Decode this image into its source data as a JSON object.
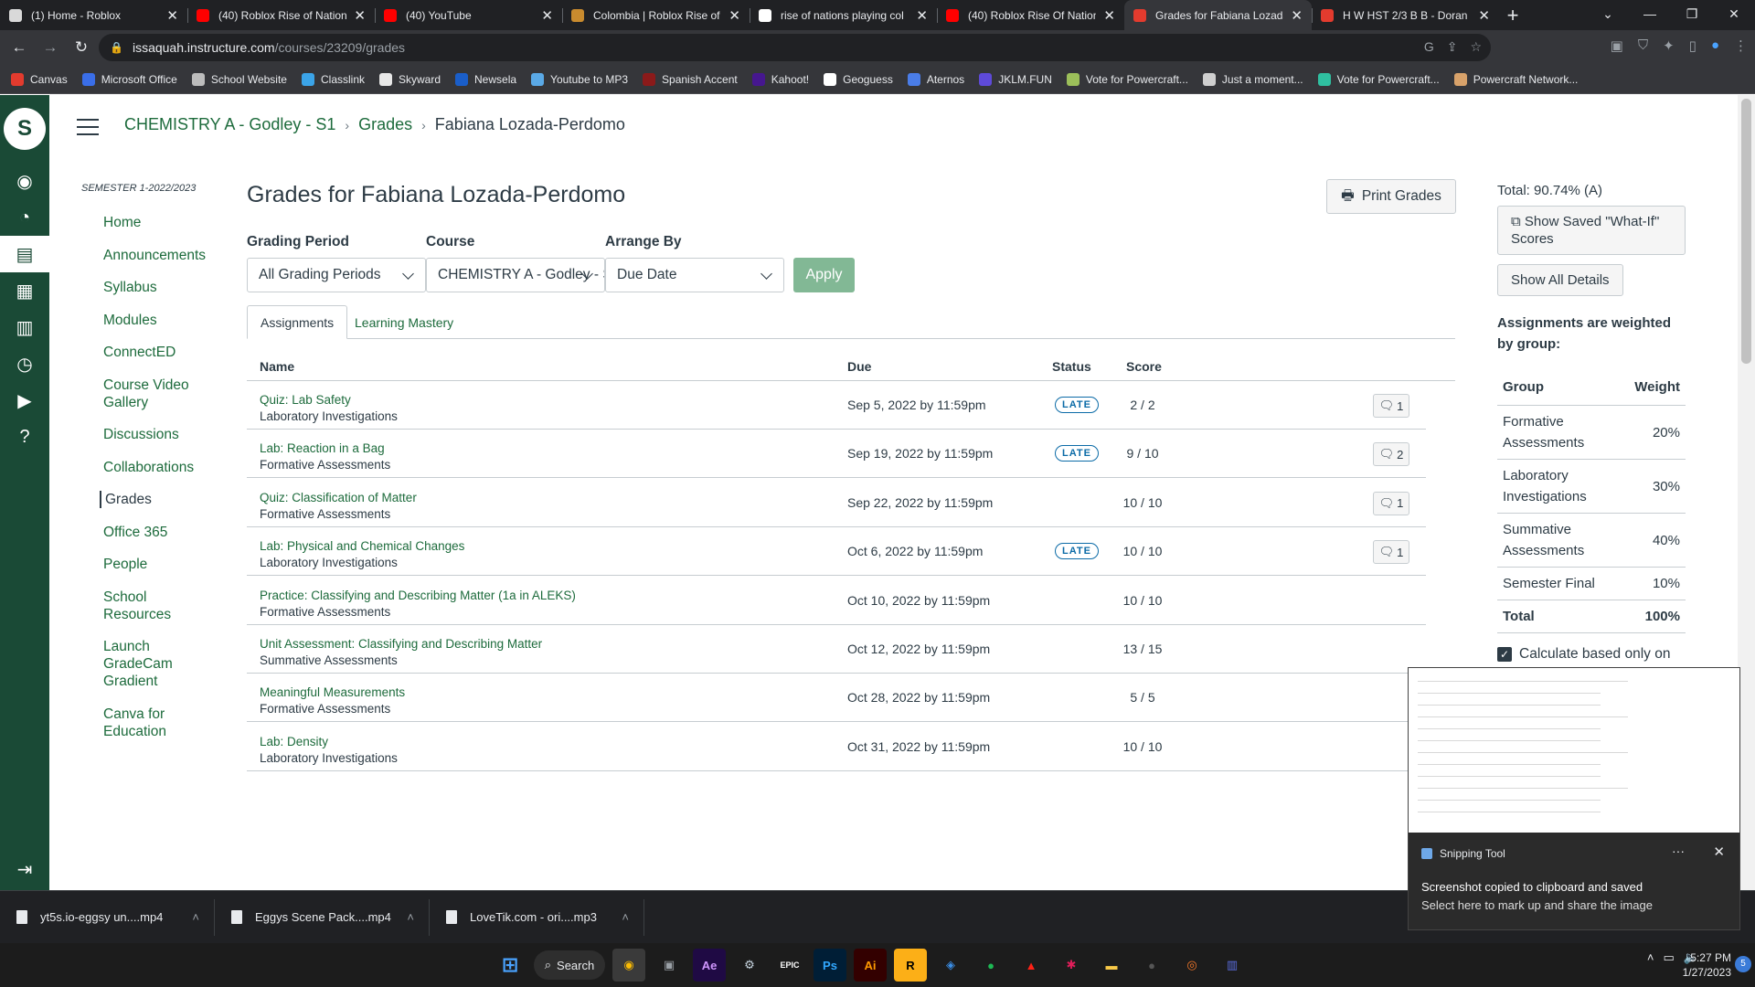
{
  "browser": {
    "tabs": [
      {
        "title": "(1) Home - Roblox",
        "fav": "#d9d9d9"
      },
      {
        "title": "(40) Roblox Rise of Nations",
        "fav": "#ff0000"
      },
      {
        "title": "(40) YouTube",
        "fav": "#ff0000"
      },
      {
        "title": "Colombia | Roblox Rise of",
        "fav": "#c98b2e"
      },
      {
        "title": "rise of nations playing col",
        "fav": "#ffffff"
      },
      {
        "title": "(40) Roblox Rise Of Nation",
        "fav": "#ff0000"
      },
      {
        "title": "Grades for Fabiana Lozada",
        "fav": "#e33b2e",
        "active": true
      },
      {
        "title": "H W HST 2/3 B B - Doran",
        "fav": "#e33b2e"
      }
    ],
    "url_domain": "issaquah.instructure.com",
    "url_path": "/courses/23209/grades",
    "bookmarks": [
      {
        "label": "Canvas",
        "color": "#e33b2e"
      },
      {
        "label": "Microsoft Office",
        "color": "#3a6ee8"
      },
      {
        "label": "School Website",
        "color": "#bcbcbc"
      },
      {
        "label": "Classlink",
        "color": "#3ba4e8"
      },
      {
        "label": "Skyward",
        "color": "#e8e8e8"
      },
      {
        "label": "Newsela",
        "color": "#1a5ec9"
      },
      {
        "label": "Youtube to MP3",
        "color": "#5aa9e6"
      },
      {
        "label": "Spanish Accent",
        "color": "#8b1a1a"
      },
      {
        "label": "Kahoot!",
        "color": "#46178f"
      },
      {
        "label": "Geoguess",
        "color": "#ffffff"
      },
      {
        "label": "Aternos",
        "color": "#4a7de8"
      },
      {
        "label": "JKLM.FUN",
        "color": "#5e4ad8"
      },
      {
        "label": "Vote for Powercraft...",
        "color": "#9cbf5a"
      },
      {
        "label": "Just a moment...",
        "color": "#cfcfcf"
      },
      {
        "label": "Vote for Powercraft...",
        "color": "#2fbfa0"
      },
      {
        "label": "Powercraft Network...",
        "color": "#d8a26a"
      }
    ]
  },
  "breadcrumbs": {
    "course": "CHEMISTRY A - Godley - S1",
    "section": "Grades",
    "current": "Fabiana Lozada-Perdomo",
    "sep": "›"
  },
  "course_nav": {
    "semester": "SEMESTER 1-2022/2023",
    "items": [
      "Home",
      "Announcements",
      "Syllabus",
      "Modules",
      "ConnectED",
      "Course Video Gallery",
      "Discussions",
      "Collaborations",
      "Grades",
      "Office 365",
      "People",
      "School Resources",
      "Launch GradeCam Gradient",
      "Canva for Education"
    ],
    "active": "Grades"
  },
  "page": {
    "title": "Grades for Fabiana Lozada-Perdomo",
    "print_label": "Print Grades",
    "filters": {
      "grading_period_label": "Grading Period",
      "grading_period_value": "All Grading Periods",
      "course_label": "Course",
      "course_value": "CHEMISTRY A - Godley - S",
      "arrange_label": "Arrange By",
      "arrange_value": "Due Date",
      "apply_label": "Apply"
    },
    "tabs": [
      "Assignments",
      "Learning Mastery"
    ],
    "columns": {
      "name": "Name",
      "due": "Due",
      "status": "Status",
      "score": "Score"
    },
    "assignments": [
      {
        "name": "Quiz: Lab Safety",
        "group": "Laboratory Investigations",
        "due": "Sep 5, 2022 by 11:59pm",
        "status": "LATE",
        "score": "2 / 2",
        "comments": "1"
      },
      {
        "name": "Lab: Reaction in a Bag",
        "group": "Formative Assessments",
        "due": "Sep 19, 2022 by 11:59pm",
        "status": "LATE",
        "score": "9 / 10",
        "comments": "2"
      },
      {
        "name": "Quiz: Classification of Matter",
        "group": "Formative Assessments",
        "due": "Sep 22, 2022 by 11:59pm",
        "status": "",
        "score": "10 / 10",
        "comments": "1"
      },
      {
        "name": "Lab: Physical and Chemical Changes",
        "group": "Laboratory Investigations",
        "due": "Oct 6, 2022 by 11:59pm",
        "status": "LATE",
        "score": "10 / 10",
        "comments": "1"
      },
      {
        "name": "Practice: Classifying and Describing Matter (1a in ALEKS)",
        "group": "Formative Assessments",
        "due": "Oct 10, 2022 by 11:59pm",
        "status": "",
        "score": "10 / 10",
        "comments": ""
      },
      {
        "name": "Unit Assessment: Classifying and Describing Matter",
        "group": "Summative Assessments",
        "due": "Oct 12, 2022 by 11:59pm",
        "status": "",
        "score": "13 / 15",
        "comments": ""
      },
      {
        "name": "Meaningful Measurements",
        "group": "Formative Assessments",
        "due": "Oct 28, 2022 by 11:59pm",
        "status": "",
        "score": "5 / 5",
        "comments": ""
      },
      {
        "name": "Lab: Density",
        "group": "Laboratory Investigations",
        "due": "Oct 31, 2022 by 11:59pm",
        "status": "",
        "score": "10 / 10",
        "comments": ""
      }
    ]
  },
  "sidebar": {
    "total": "Total: 90.74% (A)",
    "what_if_label": "Show Saved \"What-If\" Scores",
    "show_details_label": "Show All Details",
    "weights_title": "Assignments are weighted by group:",
    "weights_header": {
      "group": "Group",
      "weight": "Weight"
    },
    "weights": [
      {
        "group": "Formative Assessments",
        "weight": "20%"
      },
      {
        "group": "Laboratory Investigations",
        "weight": "30%"
      },
      {
        "group": "Summative Assessments",
        "weight": "40%"
      },
      {
        "group": "Semester Final",
        "weight": "10%"
      },
      {
        "group": "Total",
        "weight": "100%"
      }
    ],
    "calc_label": "Calculate based only on"
  },
  "downloads": [
    {
      "name": "yt5s.io-eggsy un....mp4"
    },
    {
      "name": "Eggys Scene Pack....mp4"
    },
    {
      "name": "LoveTik.com - ori....mp3"
    }
  ],
  "toast": {
    "app": "Snipping Tool",
    "line1": "Screenshot copied to clipboard and saved",
    "line2": "Select here to mark up and share the image"
  },
  "taskbar": {
    "search_label": "Search",
    "time": "5:27 PM",
    "date": "1/27/2023",
    "notif_count": "5"
  }
}
